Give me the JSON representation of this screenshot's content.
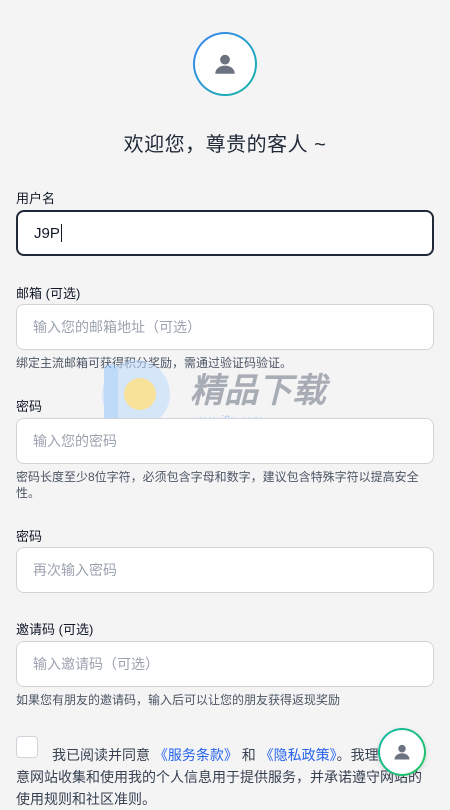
{
  "welcome": "欢迎您，尊贵的客人 ~",
  "username": {
    "label": "用户名",
    "value": "J9P"
  },
  "email": {
    "label": "邮箱 (可选)",
    "placeholder": "输入您的邮箱地址（可选）",
    "hint": "绑定主流邮箱可获得积分奖励，需通过验证码验证。"
  },
  "password": {
    "label": "密码",
    "placeholder": "输入您的密码",
    "hint": "密码长度至少8位字符，必须包含字母和数字，建议包含特殊字符以提高安全性。"
  },
  "confirm": {
    "label": "密码",
    "placeholder": "再次输入密码"
  },
  "invite": {
    "label": "邀请码 (可选)",
    "placeholder": "输入邀请码（可选）",
    "hint": "如果您有朋友的邀请码，输入后可以让您的朋友获得返现奖励"
  },
  "agreement": {
    "prefix": "我已阅读并同意 ",
    "terms": "《服务条款》",
    "and": " 和 ",
    "privacy": "《隐私政策》",
    "suffix": "。我理解并同意网站收集和使用我的个人信息用于提供服务，并承诺遵守网站的使用规则和社区准则。"
  },
  "watermark": {
    "title": "精品下载",
    "url": "www.j9p.com"
  },
  "colors": {
    "accent": "#2563eb",
    "avatar_gradient_start": "#3b82f6",
    "avatar_gradient_end": "#14b8a6"
  },
  "icons": [
    "user-icon"
  ]
}
